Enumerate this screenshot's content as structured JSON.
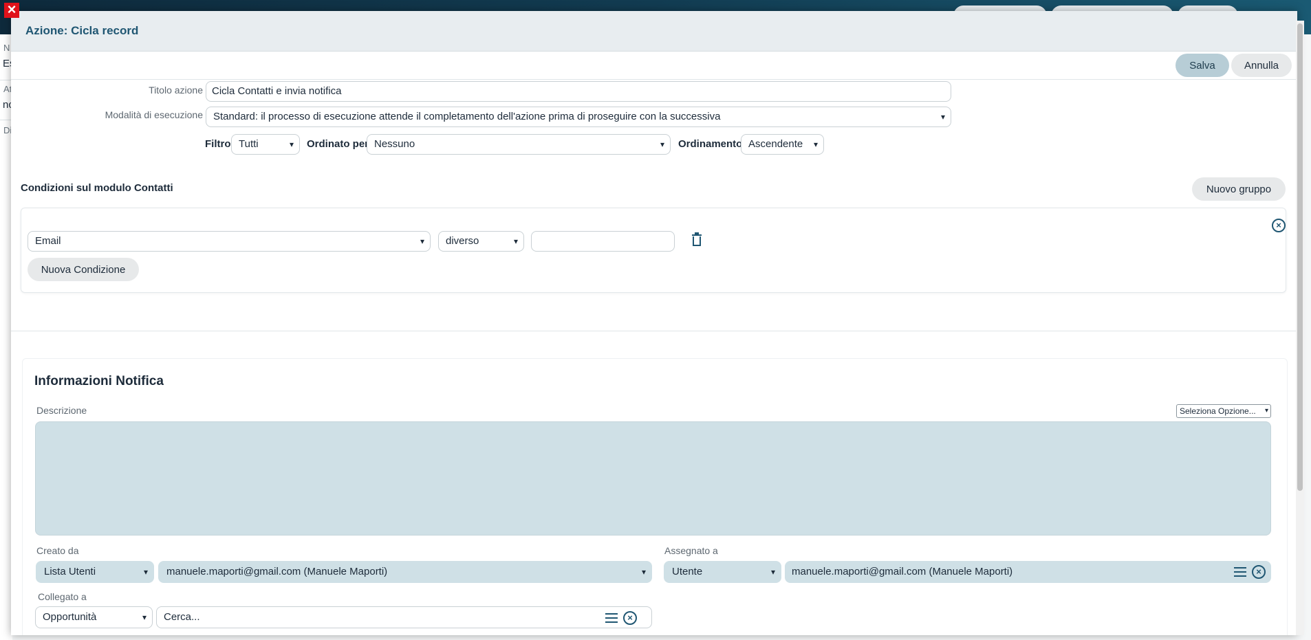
{
  "modal": {
    "title": "Azione: Cicla record",
    "save_label": "Salva",
    "cancel_label": "Annulla"
  },
  "form": {
    "title_label": "Titolo azione",
    "title_value": "Cicla Contatti e invia notifica",
    "mode_label": "Modalità di esecuzione",
    "mode_value": "Standard: il processo di esecuzione attende il completamento dell'azione prima di proseguire con la successiva",
    "filter_label": "Filtro",
    "filter_value": "Tutti",
    "order_by_label": "Ordinato per",
    "order_by_value": "Nessuno",
    "ordering_label": "Ordinamento",
    "ordering_value": "Ascendente"
  },
  "conditions": {
    "title": "Condizioni sul modulo Contatti",
    "new_group_label": "Nuovo gruppo",
    "field_value": "Email",
    "operator_value": "diverso",
    "compare_value": "",
    "new_condition_label": "Nuova Condizione"
  },
  "notification": {
    "title": "Informazioni Notifica",
    "description_label": "Descrizione",
    "option_select": "Seleziona Opzione...",
    "created_by_label": "Creato da",
    "created_by_type": "Lista Utenti",
    "created_by_value": "manuele.maporti@gmail.com (Manuele Maporti)",
    "assigned_to_label": "Assegnato a",
    "assigned_to_type": "Utente",
    "assigned_to_value": "manuele.maporti@gmail.com (Manuele Maporti)",
    "linked_to_label": "Collegato a",
    "linked_to_type": "Opportunità",
    "linked_to_placeholder": "Cerca..."
  },
  "background": {
    "labels": [
      "N",
      "Es",
      "At",
      "nc",
      "Di"
    ]
  },
  "colors": {
    "accent": "#1f5672",
    "field_bg": "#cfe0e6",
    "save_bg": "#b7cdd6",
    "close_red": "#e0121b"
  }
}
